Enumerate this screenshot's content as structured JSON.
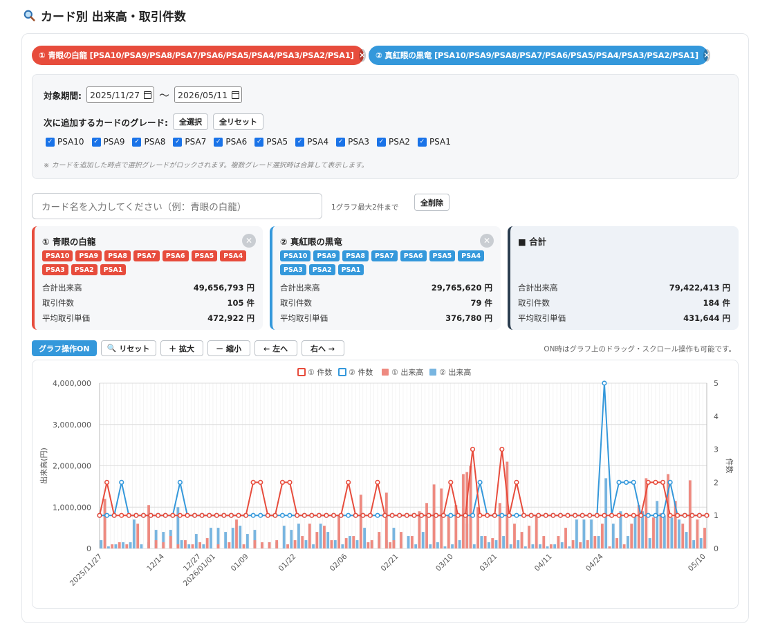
{
  "title": "カード別 出来高・取引件数",
  "pills": [
    {
      "label": "① 青眼の白龍 [PSA10/PSA9/PSA8/PSA7/PSA6/PSA5/PSA4/PSA3/PSA2/PSA1]",
      "color": "#e74c3c"
    },
    {
      "label": "② 真紅眼の黒竜 [PSA10/PSA9/PSA8/PSA7/PSA6/PSA5/PSA4/PSA3/PSA2/PSA1]",
      "color": "#3498db"
    }
  ],
  "filter": {
    "period_label": "対象期間:",
    "date_from": "2025/11/27",
    "date_to": "2026/05/11",
    "tilde": "〜",
    "grade_label": "次に追加するカードのグレード:",
    "select_all": "全選択",
    "reset_all": "全リセット",
    "grades": [
      "PSA10",
      "PSA9",
      "PSA8",
      "PSA7",
      "PSA6",
      "PSA5",
      "PSA4",
      "PSA3",
      "PSA2",
      "PSA1"
    ],
    "note": "※ カードを追加した時点で選択グレードがロックされます。複数グレード選択時は合算して表示します。"
  },
  "search": {
    "placeholder": "カード名を入力してください（例：青眼の白龍）",
    "max_note": "1グラフ最大2件まで",
    "delete_all": "全削除"
  },
  "cards": [
    {
      "title": "① 青眼の白龍",
      "tags": [
        "PSA10",
        "PSA9",
        "PSA8",
        "PSA7",
        "PSA6",
        "PSA5",
        "PSA4",
        "PSA3",
        "PSA2",
        "PSA1"
      ],
      "stats": [
        {
          "label": "合計出来高",
          "value": "49,656,793 円"
        },
        {
          "label": "取引件数",
          "value": "105 件"
        },
        {
          "label": "平均取引単価",
          "value": "472,922 円"
        }
      ]
    },
    {
      "title": "② 真紅眼の黒竜",
      "tags": [
        "PSA10",
        "PSA9",
        "PSA8",
        "PSA7",
        "PSA6",
        "PSA5",
        "PSA4",
        "PSA3",
        "PSA2",
        "PSA1"
      ],
      "stats": [
        {
          "label": "合計出来高",
          "value": "29,765,620 円"
        },
        {
          "label": "取引件数",
          "value": "79 件"
        },
        {
          "label": "平均取引単価",
          "value": "376,780 円"
        }
      ]
    },
    {
      "title": "■ 合計",
      "stats": [
        {
          "label": "合計出来高",
          "value": "79,422,413 円"
        },
        {
          "label": "取引件数",
          "value": "184 件"
        },
        {
          "label": "平均取引単価",
          "value": "431,644 円"
        }
      ]
    }
  ],
  "toolbar": {
    "toggle": "グラフ操作ON",
    "reset": "リセット",
    "zoom_in": "＋ 拡大",
    "zoom_out": "－ 縮小",
    "left": "← 左へ",
    "right": "右へ →",
    "note": "ON時はグラフ上のドラッグ・スクロール操作も可能です。"
  },
  "chart_data": {
    "type": "bar+line",
    "xlabels": [
      "2025/11/27",
      "12/14",
      "12/27",
      "2026/01/01",
      "01/09",
      "01/22",
      "02/06",
      "02/21",
      "03/10",
      "03/21",
      "04/11",
      "04/24",
      "05/10"
    ],
    "ylabel": "出来高(円)",
    "y2label": "件数",
    "ylim": [
      0,
      4000000
    ],
    "y2lim": [
      0,
      5
    ],
    "yticks": [
      "0",
      "1,000,000",
      "2,000,000",
      "3,000,000",
      "4,000,000"
    ],
    "y2ticks": [
      "0",
      "1",
      "2",
      "3",
      "4",
      "5"
    ],
    "legend": [
      "① 件数",
      "② 件数",
      "① 出来高",
      "② 出来高"
    ],
    "colors": {
      "s1": "#e74c3c",
      "s2": "#3498db",
      "bar1": "#ee8a80",
      "bar2": "#78b5e0"
    },
    "n_days": 166,
    "bars1": [
      [
        1,
        1200000
      ],
      [
        3,
        100000
      ],
      [
        5,
        150000
      ],
      [
        7,
        100000
      ],
      [
        10,
        600000
      ],
      [
        13,
        1050000
      ],
      [
        15,
        200000
      ],
      [
        17,
        150000
      ],
      [
        19,
        300000
      ],
      [
        21,
        100000
      ],
      [
        23,
        200000
      ],
      [
        25,
        100000
      ],
      [
        27,
        150000
      ],
      [
        29,
        250000
      ],
      [
        32,
        100000
      ],
      [
        35,
        150000
      ],
      [
        37,
        700000
      ],
      [
        39,
        100000
      ],
      [
        42,
        200000
      ],
      [
        44,
        150000
      ],
      [
        46,
        150000
      ],
      [
        48,
        200000
      ],
      [
        51,
        100000
      ],
      [
        53,
        200000
      ],
      [
        55,
        300000
      ],
      [
        57,
        600000
      ],
      [
        59,
        400000
      ],
      [
        61,
        550000
      ],
      [
        63,
        200000
      ],
      [
        65,
        800000
      ],
      [
        67,
        250000
      ],
      [
        69,
        300000
      ],
      [
        71,
        1300000
      ],
      [
        73,
        150000
      ],
      [
        74,
        200000
      ],
      [
        76,
        400000
      ],
      [
        78,
        1350000
      ],
      [
        79,
        150000
      ],
      [
        80,
        200000
      ],
      [
        82,
        400000
      ],
      [
        85,
        300000
      ],
      [
        87,
        900000
      ],
      [
        89,
        1100000
      ],
      [
        91,
        1550000
      ],
      [
        93,
        1450000
      ],
      [
        95,
        800000
      ],
      [
        97,
        1050000
      ],
      [
        99,
        1800000
      ],
      [
        100,
        1850000
      ],
      [
        101,
        2000000
      ],
      [
        103,
        1000000
      ],
      [
        105,
        300000
      ],
      [
        107,
        250000
      ],
      [
        109,
        1100000
      ],
      [
        111,
        2100000
      ],
      [
        113,
        600000
      ],
      [
        115,
        400000
      ],
      [
        117,
        550000
      ],
      [
        119,
        800000
      ],
      [
        121,
        300000
      ],
      [
        123,
        100000
      ],
      [
        125,
        300000
      ],
      [
        127,
        500000
      ],
      [
        129,
        200000
      ],
      [
        131,
        150000
      ],
      [
        133,
        200000
      ],
      [
        135,
        300000
      ],
      [
        137,
        600000
      ],
      [
        139,
        50000
      ],
      [
        141,
        250000
      ],
      [
        143,
        100000
      ],
      [
        145,
        600000
      ],
      [
        147,
        1050000
      ],
      [
        149,
        1700000
      ],
      [
        151,
        750000
      ],
      [
        153,
        850000
      ],
      [
        155,
        1800000
      ],
      [
        157,
        1150000
      ],
      [
        159,
        600000
      ],
      [
        161,
        1650000
      ],
      [
        163,
        700000
      ],
      [
        165,
        500000
      ]
    ],
    "bars2": [
      [
        0,
        200000
      ],
      [
        2,
        50000
      ],
      [
        4,
        100000
      ],
      [
        6,
        150000
      ],
      [
        8,
        150000
      ],
      [
        9,
        700000
      ],
      [
        11,
        100000
      ],
      [
        13,
        150000
      ],
      [
        15,
        450000
      ],
      [
        17,
        400000
      ],
      [
        19,
        450000
      ],
      [
        21,
        1000000
      ],
      [
        22,
        200000
      ],
      [
        24,
        100000
      ],
      [
        26,
        350000
      ],
      [
        28,
        100000
      ],
      [
        30,
        500000
      ],
      [
        32,
        500000
      ],
      [
        34,
        400000
      ],
      [
        36,
        500000
      ],
      [
        38,
        550000
      ],
      [
        40,
        350000
      ],
      [
        42,
        450000
      ],
      [
        44,
        100000
      ],
      [
        46,
        150000
      ],
      [
        48,
        150000
      ],
      [
        50,
        550000
      ],
      [
        52,
        450000
      ],
      [
        54,
        600000
      ],
      [
        56,
        200000
      ],
      [
        58,
        100000
      ],
      [
        60,
        600000
      ],
      [
        62,
        400000
      ],
      [
        64,
        200000
      ],
      [
        66,
        100000
      ],
      [
        68,
        300000
      ],
      [
        70,
        200000
      ],
      [
        72,
        500000
      ],
      [
        74,
        150000
      ],
      [
        76,
        300000
      ],
      [
        78,
        200000
      ],
      [
        80,
        500000
      ],
      [
        82,
        100000
      ],
      [
        84,
        300000
      ],
      [
        86,
        100000
      ],
      [
        88,
        400000
      ],
      [
        90,
        100000
      ],
      [
        92,
        150000
      ],
      [
        94,
        50000
      ],
      [
        96,
        100000
      ],
      [
        98,
        200000
      ],
      [
        100,
        600000
      ],
      [
        102,
        100000
      ],
      [
        104,
        300000
      ],
      [
        106,
        150000
      ],
      [
        108,
        200000
      ],
      [
        110,
        300000
      ],
      [
        112,
        100000
      ],
      [
        114,
        200000
      ],
      [
        116,
        50000
      ],
      [
        118,
        100000
      ],
      [
        120,
        100000
      ],
      [
        122,
        50000
      ],
      [
        124,
        100000
      ],
      [
        126,
        150000
      ],
      [
        128,
        50000
      ],
      [
        130,
        700000
      ],
      [
        132,
        700000
      ],
      [
        134,
        700000
      ],
      [
        136,
        300000
      ],
      [
        138,
        1700000
      ],
      [
        140,
        600000
      ],
      [
        142,
        900000
      ],
      [
        144,
        300000
      ],
      [
        146,
        800000
      ],
      [
        148,
        900000
      ],
      [
        150,
        250000
      ],
      [
        152,
        1150000
      ],
      [
        154,
        800000
      ],
      [
        156,
        750000
      ],
      [
        158,
        700000
      ],
      [
        160,
        400000
      ],
      [
        162,
        200000
      ],
      [
        164,
        250000
      ]
    ],
    "line1": [
      [
        0,
        1
      ],
      [
        2,
        2
      ],
      [
        4,
        1
      ],
      [
        6,
        1
      ],
      [
        8,
        1
      ],
      [
        10,
        1
      ],
      [
        12,
        1
      ],
      [
        14,
        1
      ],
      [
        16,
        1
      ],
      [
        18,
        1
      ],
      [
        20,
        1
      ],
      [
        22,
        1
      ],
      [
        24,
        1
      ],
      [
        26,
        1
      ],
      [
        28,
        1
      ],
      [
        30,
        1
      ],
      [
        32,
        1
      ],
      [
        34,
        1
      ],
      [
        36,
        1
      ],
      [
        38,
        1
      ],
      [
        40,
        1
      ],
      [
        42,
        2
      ],
      [
        44,
        2
      ],
      [
        46,
        1
      ],
      [
        48,
        1
      ],
      [
        50,
        2
      ],
      [
        52,
        2
      ],
      [
        54,
        1
      ],
      [
        56,
        1
      ],
      [
        58,
        1
      ],
      [
        60,
        1
      ],
      [
        62,
        1
      ],
      [
        64,
        1
      ],
      [
        66,
        1
      ],
      [
        68,
        2
      ],
      [
        70,
        1
      ],
      [
        72,
        1
      ],
      [
        74,
        1
      ],
      [
        76,
        2
      ],
      [
        78,
        1
      ],
      [
        80,
        1
      ],
      [
        82,
        1
      ],
      [
        84,
        1
      ],
      [
        86,
        1
      ],
      [
        88,
        1
      ],
      [
        90,
        1
      ],
      [
        92,
        1
      ],
      [
        94,
        1
      ],
      [
        96,
        2
      ],
      [
        98,
        1
      ],
      [
        100,
        1
      ],
      [
        102,
        3
      ],
      [
        104,
        1
      ],
      [
        106,
        1
      ],
      [
        108,
        1
      ],
      [
        110,
        3
      ],
      [
        112,
        1
      ],
      [
        114,
        2
      ],
      [
        116,
        1
      ],
      [
        118,
        1
      ],
      [
        120,
        1
      ],
      [
        122,
        1
      ],
      [
        124,
        1
      ],
      [
        126,
        1
      ],
      [
        128,
        1
      ],
      [
        130,
        1
      ],
      [
        132,
        1
      ],
      [
        134,
        1
      ],
      [
        136,
        1
      ],
      [
        138,
        1
      ],
      [
        140,
        1
      ],
      [
        142,
        1
      ],
      [
        144,
        1
      ],
      [
        146,
        1
      ],
      [
        148,
        1
      ],
      [
        150,
        2
      ],
      [
        152,
        2
      ],
      [
        154,
        2
      ],
      [
        156,
        1
      ],
      [
        158,
        1
      ],
      [
        160,
        1
      ],
      [
        162,
        1
      ],
      [
        164,
        1
      ],
      [
        166,
        1
      ]
    ],
    "line2": [
      [
        0,
        1
      ],
      [
        2,
        1
      ],
      [
        4,
        1
      ],
      [
        6,
        2
      ],
      [
        8,
        1
      ],
      [
        10,
        1
      ],
      [
        12,
        1
      ],
      [
        14,
        1
      ],
      [
        16,
        1
      ],
      [
        18,
        1
      ],
      [
        20,
        1
      ],
      [
        22,
        2
      ],
      [
        24,
        1
      ],
      [
        26,
        1
      ],
      [
        28,
        1
      ],
      [
        30,
        1
      ],
      [
        32,
        1
      ],
      [
        34,
        1
      ],
      [
        36,
        1
      ],
      [
        38,
        1
      ],
      [
        40,
        1
      ],
      [
        42,
        1
      ],
      [
        44,
        1
      ],
      [
        46,
        1
      ],
      [
        48,
        1
      ],
      [
        50,
        1
      ],
      [
        52,
        1
      ],
      [
        54,
        1
      ],
      [
        56,
        1
      ],
      [
        58,
        1
      ],
      [
        60,
        1
      ],
      [
        62,
        1
      ],
      [
        64,
        1
      ],
      [
        66,
        1
      ],
      [
        68,
        1
      ],
      [
        70,
        1
      ],
      [
        72,
        1
      ],
      [
        74,
        1
      ],
      [
        76,
        1
      ],
      [
        78,
        1
      ],
      [
        80,
        1
      ],
      [
        82,
        1
      ],
      [
        84,
        1
      ],
      [
        86,
        1
      ],
      [
        88,
        1
      ],
      [
        90,
        1
      ],
      [
        92,
        1
      ],
      [
        94,
        1
      ],
      [
        96,
        1
      ],
      [
        98,
        1
      ],
      [
        100,
        1
      ],
      [
        102,
        1
      ],
      [
        104,
        2
      ],
      [
        106,
        1
      ],
      [
        108,
        1
      ],
      [
        110,
        1
      ],
      [
        112,
        1
      ],
      [
        114,
        1
      ],
      [
        116,
        1
      ],
      [
        118,
        1
      ],
      [
        120,
        1
      ],
      [
        122,
        1
      ],
      [
        124,
        1
      ],
      [
        126,
        1
      ],
      [
        128,
        1
      ],
      [
        130,
        1
      ],
      [
        132,
        1
      ],
      [
        134,
        1
      ],
      [
        136,
        1
      ],
      [
        138,
        5
      ],
      [
        140,
        1
      ],
      [
        142,
        2
      ],
      [
        144,
        2
      ],
      [
        146,
        2
      ],
      [
        148,
        1
      ],
      [
        150,
        1
      ],
      [
        152,
        1
      ],
      [
        154,
        1
      ],
      [
        156,
        2
      ],
      [
        158,
        1
      ],
      [
        160,
        1
      ],
      [
        162,
        1
      ],
      [
        164,
        1
      ],
      [
        166,
        1
      ]
    ]
  }
}
